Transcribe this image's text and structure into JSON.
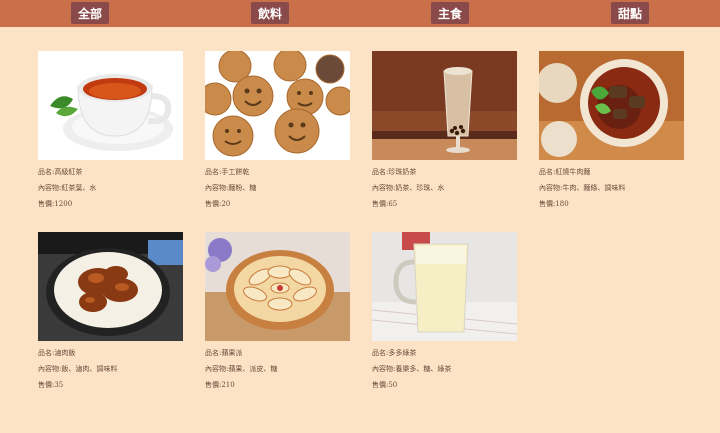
{
  "nav": {
    "items": [
      {
        "label": "全部"
      },
      {
        "label": "飲料"
      },
      {
        "label": "主食"
      },
      {
        "label": "甜點"
      }
    ]
  },
  "products": [
    {
      "name": "品名:高級紅茶",
      "contents": "內容物:紅茶葉、水",
      "price": "售價:1200",
      "image": "red-tea-cup"
    },
    {
      "name": "品名:手工餅乾",
      "contents": "內容物:麵粉、糖",
      "price": "售價:20",
      "image": "smiley-cookies"
    },
    {
      "name": "品名:珍珠奶茶",
      "contents": "內容物:奶茶、珍珠、水",
      "price": "售價:65",
      "image": "bubble-milk-tea"
    },
    {
      "name": "品名:紅燒牛肉麵",
      "contents": "內容物:牛肉、麵條、調味料",
      "price": "售價:180",
      "image": "beef-noodle-soup"
    },
    {
      "name": "品名:滷肉飯",
      "contents": "內容物:飯、滷肉、調味料",
      "price": "售價:35",
      "image": "braised-pork-rice"
    },
    {
      "name": "品名:蘋果派",
      "contents": "內容物:蘋果、派皮、糖",
      "price": "售價:210",
      "image": "apple-pie"
    },
    {
      "name": "品名:多多綠茶",
      "contents": "內容物:養樂多、糖、綠茶",
      "price": "售價:50",
      "image": "yakult-green-tea"
    }
  ]
}
